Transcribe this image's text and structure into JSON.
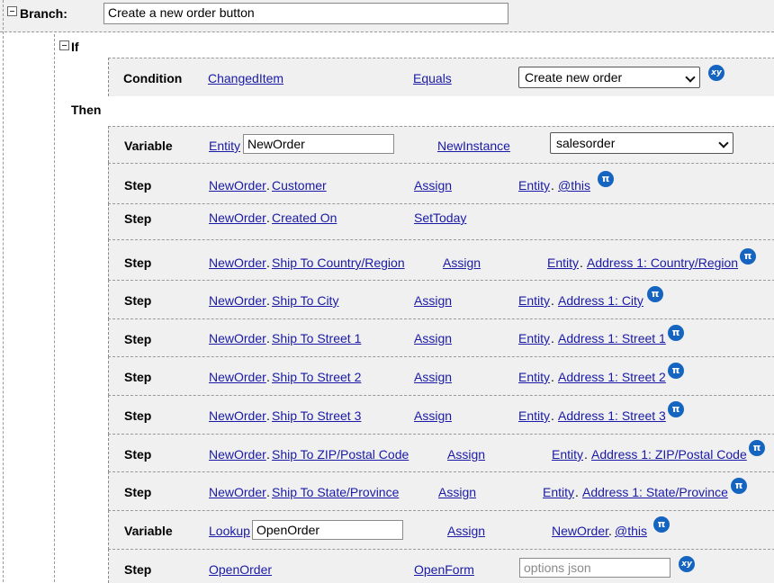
{
  "branch": {
    "label": "Branch:",
    "name_value": "Create a new order button"
  },
  "if_block": {
    "label": "If",
    "condition": {
      "label": "Condition",
      "field": "ChangedItem",
      "operator": "Equals",
      "value": "Create new order",
      "badge": "xy"
    }
  },
  "then_label": "Then",
  "variable1": {
    "label": "Variable",
    "type_link": "Entity",
    "name_value": "NewOrder",
    "action": "NewInstance",
    "select_value": "salesorder"
  },
  "steps": [
    {
      "label": "Step",
      "obj": "NewOrder",
      "field": "Customer",
      "action": "Assign",
      "src": "Entity",
      "src_field": "@this",
      "badge": "π"
    },
    {
      "label": "Step",
      "obj": "NewOrder",
      "field": "Created On",
      "action": "SetToday"
    },
    {
      "label": "Step",
      "obj": "NewOrder",
      "field": "Ship To Country/Region",
      "action": "Assign",
      "src": "Entity",
      "src_field": "Address 1: Country/Region",
      "badge": "π"
    },
    {
      "label": "Step",
      "obj": "NewOrder",
      "field": "Ship To City",
      "action": "Assign",
      "src": "Entity",
      "src_field": "Address 1: City",
      "badge": "π"
    },
    {
      "label": "Step",
      "obj": "NewOrder",
      "field": "Ship To Street 1",
      "action": "Assign",
      "src": "Entity",
      "src_field": "Address 1: Street 1",
      "badge": "π"
    },
    {
      "label": "Step",
      "obj": "NewOrder",
      "field": "Ship To Street 2",
      "action": "Assign",
      "src": "Entity",
      "src_field": "Address 1: Street 2",
      "badge": "π"
    },
    {
      "label": "Step",
      "obj": "NewOrder",
      "field": "Ship To Street 3",
      "action": "Assign",
      "src": "Entity",
      "src_field": "Address 1: Street 3",
      "badge": "π"
    },
    {
      "label": "Step",
      "obj": "NewOrder",
      "field": "Ship To ZIP/Postal Code",
      "action": "Assign",
      "src": "Entity",
      "src_field": "Address 1: ZIP/Postal Code",
      "badge": "π"
    },
    {
      "label": "Step",
      "obj": "NewOrder",
      "field": "Ship To State/Province",
      "action": "Assign",
      "src": "Entity",
      "src_field": "Address 1: State/Province",
      "badge": "π"
    }
  ],
  "variable2": {
    "label": "Variable",
    "type_link": "Lookup",
    "name_value": "OpenOrder",
    "action": "Assign",
    "src": "NewOrder",
    "src_field": "@this",
    "badge": "π"
  },
  "last_step": {
    "label": "Step",
    "obj": "OpenOrder",
    "action": "OpenForm",
    "placeholder": "options json",
    "badge": "xy"
  },
  "separator": ".",
  "colors": {
    "link": "#1a1aa6",
    "badge": "#1565c0",
    "row_bg": "#f0f0f0"
  }
}
